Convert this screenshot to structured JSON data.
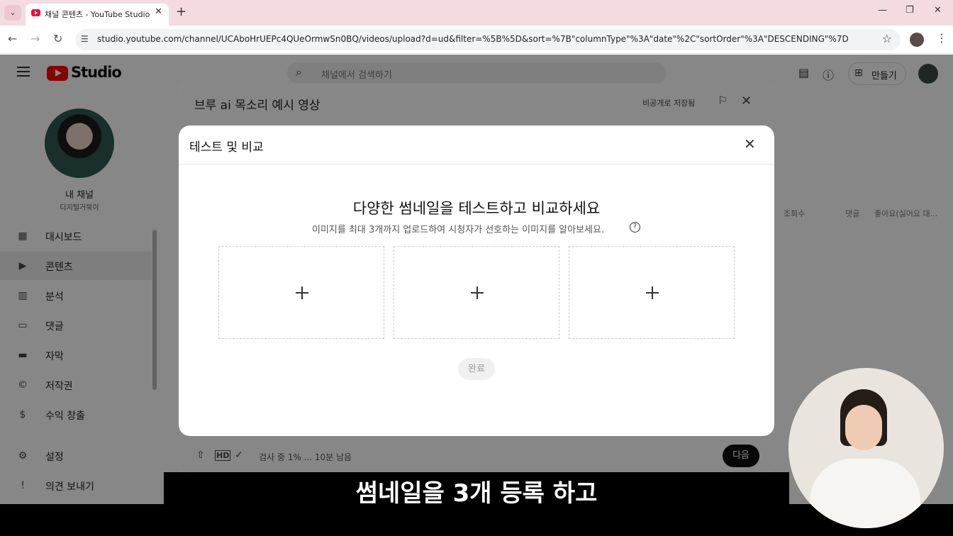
{
  "browser": {
    "tab_title": "채널 콘텐츠 - YouTube Studio",
    "url": "studio.youtube.com/channel/UCAboHrUEPc4QUeOrmwSn0BQ/videos/upload?d=ud&filter=%5B%5D&sort=%7B\"columnType\"%3A\"date\"%2C\"sortOrder\"%3A\"DESCENDING\"%7D"
  },
  "studio": {
    "logo": "Studio",
    "search_placeholder": "채널에서 검색하기",
    "create_label": "만들기",
    "channel": {
      "title": "내 채널",
      "name": "디지털거북이"
    },
    "nav": [
      {
        "label": "대시보드",
        "icon": "dashboard-icon"
      },
      {
        "label": "콘텐츠",
        "icon": "content-icon",
        "active": true
      },
      {
        "label": "분석",
        "icon": "analytics-icon"
      },
      {
        "label": "댓글",
        "icon": "comments-icon"
      },
      {
        "label": "자막",
        "icon": "subtitles-icon"
      },
      {
        "label": "저작권",
        "icon": "copyright-icon"
      },
      {
        "label": "수익 창출",
        "icon": "monetization-icon"
      },
      {
        "label": "설정",
        "icon": "settings-icon"
      },
      {
        "label": "의견 보내기",
        "icon": "feedback-icon"
      }
    ],
    "table_headers": [
      "조회수",
      "댓글",
      "좋아요(싫어요 대..."
    ]
  },
  "upload_dialog": {
    "title": "브루 ai 목소리 예시 영상",
    "status": "비공개로 저장됨",
    "footer_status": "검사 중 1% ... 10분 남음",
    "next_label": "다음"
  },
  "modal": {
    "title": "테스트 및 비교",
    "heading": "다양한 썸네일을 테스트하고 비교하세요",
    "description": "이미지를 최대 3개까지 업로드하여 시청자가 선호하는 이미지를 알아보세요.",
    "help_glyph": "?",
    "slots": 3,
    "done_label": "완료"
  },
  "video_caption": "썸네일을 3개 등록 하고"
}
